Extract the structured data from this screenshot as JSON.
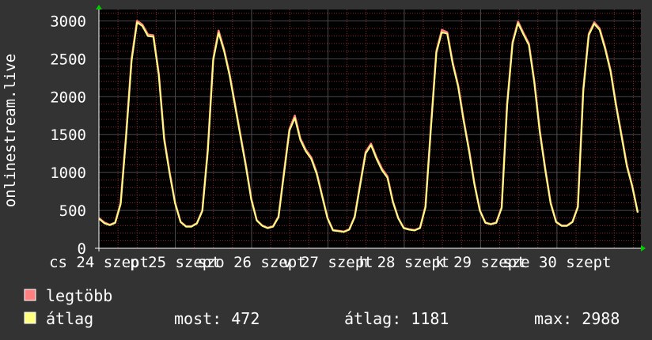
{
  "chart_data": {
    "type": "line",
    "ylabel": "onlinestream.live",
    "ylim": [
      0,
      3150
    ],
    "yticks": [
      0,
      500,
      1000,
      1500,
      2000,
      2500,
      3000
    ],
    "xticks": [
      "cs 24 szept",
      "p 25 szept",
      "szo 26 szept",
      "v 27 szept",
      "h 28 szept",
      "k 29 szept",
      "sze 30 szept"
    ],
    "grid": true,
    "background": "#000000",
    "grid_color": "#4a4a4a",
    "minor_grid_color": "#8b2a2a",
    "series": [
      {
        "name": "legtöbb",
        "color": "#ff8080",
        "values": [
          400,
          340,
          310,
          340,
          600,
          1500,
          2500,
          3000,
          2950,
          2820,
          2810,
          2300,
          1450,
          1000,
          600,
          350,
          290,
          290,
          330,
          500,
          1300,
          2500,
          2870,
          2620,
          2300,
          1900,
          1500,
          1100,
          650,
          370,
          300,
          270,
          290,
          420,
          1000,
          1570,
          1750,
          1450,
          1300,
          1200,
          1000,
          700,
          400,
          240,
          230,
          220,
          250,
          420,
          850,
          1270,
          1380,
          1200,
          1050,
          950,
          620,
          400,
          270,
          250,
          240,
          270,
          550,
          1600,
          2600,
          2880,
          2850,
          2450,
          2150,
          1700,
          1300,
          850,
          500,
          340,
          320,
          340,
          540,
          1900,
          2720,
          2990,
          2840,
          2700,
          2200,
          1550,
          1050,
          600,
          350,
          300,
          300,
          350,
          550,
          2100,
          2830,
          2980,
          2900,
          2650,
          2350,
          1900,
          1500,
          1100,
          820,
          470
        ],
        "type": "line"
      },
      {
        "name": "átlag",
        "color": "#ffff80",
        "values": [
          390,
          330,
          305,
          335,
          580,
          1470,
          2470,
          2980,
          2930,
          2800,
          2790,
          2280,
          1430,
          980,
          590,
          345,
          285,
          285,
          325,
          490,
          1280,
          2480,
          2840,
          2600,
          2280,
          1880,
          1480,
          1080,
          640,
          365,
          295,
          265,
          285,
          410,
          980,
          1550,
          1720,
          1430,
          1280,
          1180,
          980,
          690,
          395,
          235,
          225,
          215,
          245,
          410,
          830,
          1250,
          1360,
          1180,
          1030,
          930,
          610,
          395,
          265,
          245,
          235,
          265,
          540,
          1580,
          2580,
          2850,
          2830,
          2430,
          2130,
          1680,
          1280,
          840,
          495,
          335,
          315,
          335,
          530,
          1880,
          2700,
          2970,
          2820,
          2680,
          2180,
          1530,
          1030,
          590,
          345,
          295,
          295,
          345,
          540,
          2080,
          2810,
          2960,
          2880,
          2630,
          2330,
          1880,
          1480,
          1080,
          810,
          472
        ],
        "type": "line"
      }
    ],
    "legend": [
      {
        "label": "legtöbb",
        "color": "#ff8080"
      },
      {
        "label": "átlag",
        "color": "#ffff80"
      }
    ],
    "stats": {
      "most": "most: 472",
      "atlag": "átlag: 1181",
      "max": "max: 2988"
    }
  }
}
